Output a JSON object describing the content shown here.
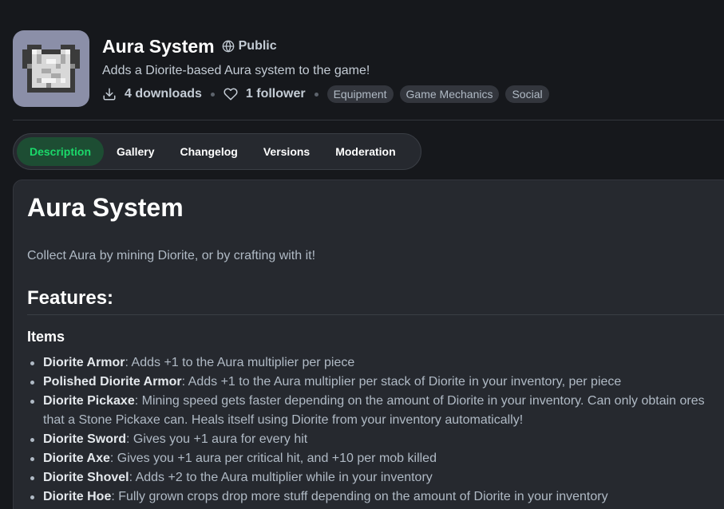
{
  "project": {
    "title": "Aura System",
    "visibility": "Public",
    "summary": "Adds a Diorite-based Aura system to the game!",
    "downloads": "4 downloads",
    "followers": "1 follower",
    "tags": [
      "Equipment",
      "Game Mechanics",
      "Social"
    ]
  },
  "tabs": [
    "Description",
    "Gallery",
    "Changelog",
    "Versions",
    "Moderation"
  ],
  "description": {
    "heading": "Aura System",
    "intro": "Collect Aura by mining Diorite, or by crafting with it!",
    "features_heading": "Features:",
    "items_heading": "Items",
    "items": [
      {
        "name": "Diorite Armor",
        "text": ": Adds +1 to the Aura multiplier per piece"
      },
      {
        "name": "Polished Diorite Armor",
        "text": ": Adds +1 to the Aura multiplier per stack of Diorite in your inventory, per piece"
      },
      {
        "name": "Diorite Pickaxe",
        "text": ": Mining speed gets faster depending on the amount of Diorite in your inventory. Can only obtain ores that a Stone Pickaxe can. Heals itself using Diorite from your inventory automatically!"
      },
      {
        "name": "Diorite Sword",
        "text": ": Gives you +1 aura for every hit"
      },
      {
        "name": "Diorite Axe",
        "text": ": Gives you +1 aura per critical hit, and +10 per mob killed"
      },
      {
        "name": "Diorite Shovel",
        "text": ": Adds +2 to the Aura multiplier while in your inventory"
      },
      {
        "name": "Diorite Hoe",
        "text": ": Fully grown crops drop more stuff depending on the amount of Diorite in your inventory"
      }
    ]
  },
  "colors": {
    "background": "#16181c",
    "card": "#26292f",
    "accent": "#1bd96a",
    "active_tab_bg": "#1d4d33",
    "icon_bg": "#8b8fa8"
  },
  "icons": {
    "project": "diorite-chestplate-icon",
    "visibility": "globe-icon",
    "downloads": "download-icon",
    "followers": "heart-icon"
  }
}
